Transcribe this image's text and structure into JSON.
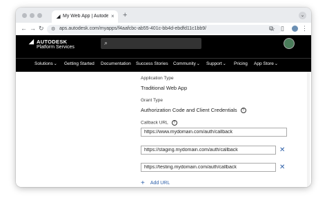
{
  "browser": {
    "tab_title": "My Web App | Autodesk Platfo",
    "tab_icon": "autodesk-favicon",
    "new_tab_symbol": "+",
    "url": "aps.autodesk.com/myapps/f4aafcbc-ab55-401c-bb4d-ebdfd11c1bb9/"
  },
  "header": {
    "logo_line1": "AUTODESK",
    "logo_line2": "Platform Services",
    "search_placeholder": ""
  },
  "nav": {
    "items": [
      {
        "label": "Solutions",
        "has_menu": true
      },
      {
        "label": "Getting Started",
        "has_menu": false
      },
      {
        "label": "Documentation",
        "has_menu": false
      },
      {
        "label": "Success Stories",
        "has_menu": false
      },
      {
        "label": "Community",
        "has_menu": true
      },
      {
        "label": "Support",
        "has_menu": true
      },
      {
        "label": "Pricing",
        "has_menu": false
      },
      {
        "label": "App Store",
        "has_menu": true
      }
    ]
  },
  "form": {
    "application_type_label": "Application Type",
    "application_type_value": "Traditional Web App",
    "grant_type_label": "Grant Type",
    "grant_type_value": "Authorization Code and Client Credentials",
    "callback_url_label": "Callback URL",
    "callback_urls": [
      "https://www.mydomain.com/auth/callback",
      "https://staging.mydomain.com/auth/callback",
      "https://testing.mydomain.com/auth/callback"
    ],
    "add_url_label": "Add URL"
  },
  "colors": {
    "accent_blue": "#2c5ea8",
    "header_bg": "#000000"
  }
}
